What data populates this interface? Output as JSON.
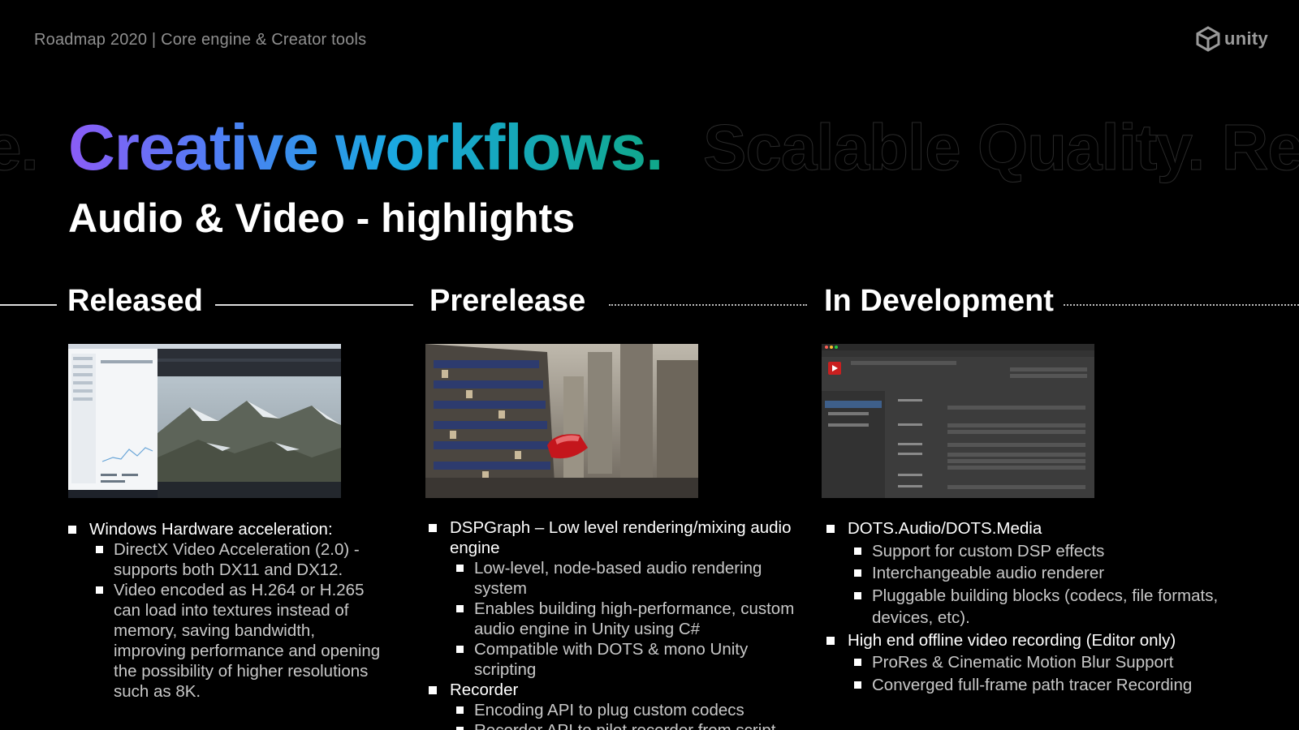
{
  "header": {
    "breadcrumb": "Roadmap 2020  | Core engine & Creator tools",
    "logo_text": "unity",
    "logo_icon": "unity-cube-icon"
  },
  "title": {
    "ghost_left": "e.",
    "main": "Creative workflows.",
    "ghost_right": "Scalable Quality.  Re",
    "gradient": [
      "#8b5cf6",
      "#4f7ef5",
      "#1aa8e0",
      "#10a889"
    ]
  },
  "subtitle": "Audio & Video - highlights",
  "columns": [
    {
      "heading": "Released",
      "image": "windows-task-manager-and-mountain-video-screenshot",
      "items": [
        {
          "text": "Windows Hardware acceleration:",
          "sub": [
            "DirectX Video Acceleration (2.0) - supports both DX11 and DX12.",
            "Video encoded as H.264 or H.265 can load into textures instead of memory, saving bandwidth, improving performance and opening the possibility of higher resolutions such as 8K."
          ]
        }
      ]
    },
    {
      "heading": "Prerelease",
      "image": "futuristic-city-render-screenshot",
      "items": [
        {
          "text": "DSPGraph – Low level rendering/mixing audio engine",
          "sub": [
            "Low-level, node-based audio rendering system",
            "Enables building high-performance, custom audio engine in Unity using C#",
            "Compatible with DOTS & mono Unity scripting"
          ]
        },
        {
          "text": "Recorder",
          "sub": [
            "Encoding API to plug custom codecs",
            "Recorder API to pilot recorder from script"
          ]
        }
      ]
    },
    {
      "heading": "In Development",
      "image": "unity-recorder-window-screenshot",
      "items": [
        {
          "text": "DOTS.Audio/DOTS.Media",
          "sub": [
            "Support for custom DSP effects",
            "Interchangeable audio renderer",
            "Pluggable building blocks (codecs, file formats, devices, etc)."
          ]
        },
        {
          "text": "High end offline video recording (Editor only)",
          "sub": [
            "ProRes & Cinematic Motion Blur Support",
            "Converged full-frame path tracer Recording"
          ]
        }
      ]
    }
  ]
}
